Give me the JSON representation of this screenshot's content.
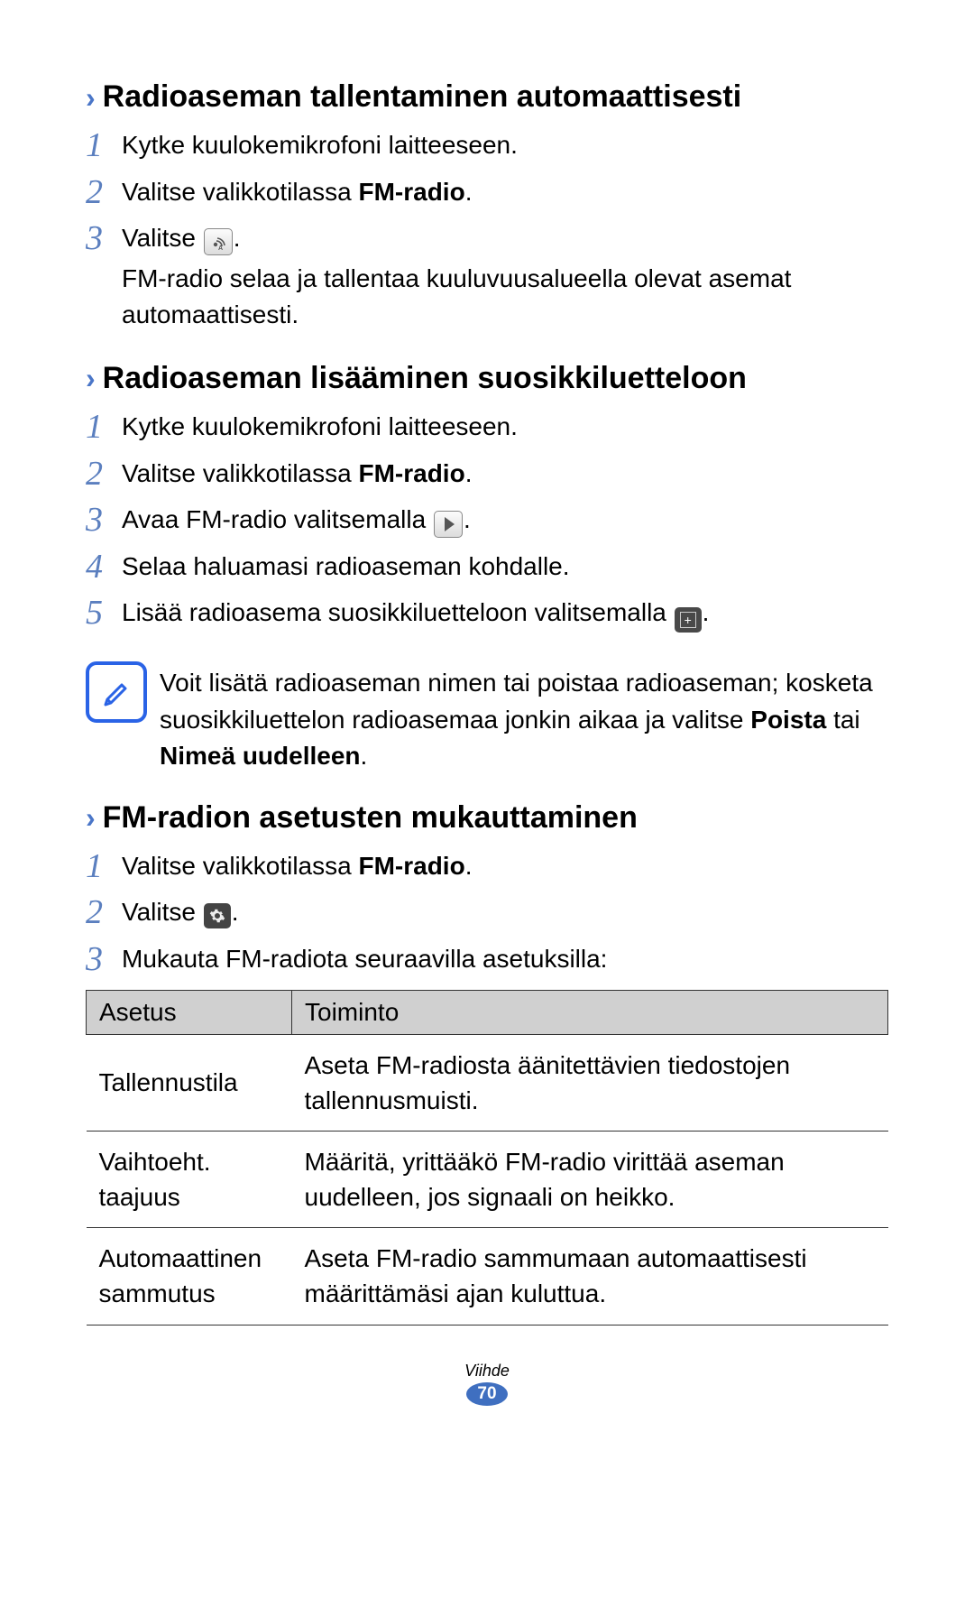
{
  "sections": {
    "s1": {
      "title": "Radioaseman tallentaminen automaattisesti",
      "steps": {
        "1": "Kytke kuulokemikrofoni laitteeseen.",
        "2_a": "Valitse valikkotilassa ",
        "2_b": "FM-radio",
        "2_c": ".",
        "3_a": "Valitse ",
        "3_b": ".",
        "3_sub": "FM-radio selaa ja tallentaa kuuluvuusalueella olevat asemat automaattisesti."
      }
    },
    "s2": {
      "title": "Radioaseman lisääminen suosikkiluetteloon",
      "steps": {
        "1": "Kytke kuulokemikrofoni laitteeseen.",
        "2_a": "Valitse valikkotilassa ",
        "2_b": "FM-radio",
        "2_c": ".",
        "3_a": "Avaa FM-radio valitsemalla ",
        "3_b": ".",
        "4": "Selaa haluamasi radioaseman kohdalle.",
        "5_a": "Lisää radioasema suosikkiluetteloon valitsemalla ",
        "5_b": "."
      },
      "note_a": "Voit lisätä radioaseman nimen tai poistaa radioaseman; kosketa suosikkiluettelon radioasemaa jonkin aikaa ja valitse ",
      "note_b": "Poista",
      "note_c": " tai ",
      "note_d": "Nimeä uudelleen",
      "note_e": "."
    },
    "s3": {
      "title": "FM-radion asetusten mukauttaminen",
      "steps": {
        "1_a": "Valitse valikkotilassa ",
        "1_b": "FM-radio",
        "1_c": ".",
        "2_a": "Valitse ",
        "2_b": ".",
        "3": "Mukauta FM-radiota seuraavilla asetuksilla:"
      },
      "table": {
        "h1": "Asetus",
        "h2": "Toiminto",
        "r1c1": "Tallennustila",
        "r1c2": "Aseta FM-radiosta äänitettävien tiedostojen tallennusmuisti.",
        "r2c1": "Vaihtoeht. taajuus",
        "r2c2": "Määritä, yrittääkö FM-radio virittää aseman uudelleen, jos signaali on heikko.",
        "r3c1": "Automaattinen sammutus",
        "r3c2": "Aseta FM-radio sammumaan automaattisesti määrittämäsi ajan kuluttua."
      }
    }
  },
  "footer": {
    "category": "Viihde",
    "page": "70"
  }
}
